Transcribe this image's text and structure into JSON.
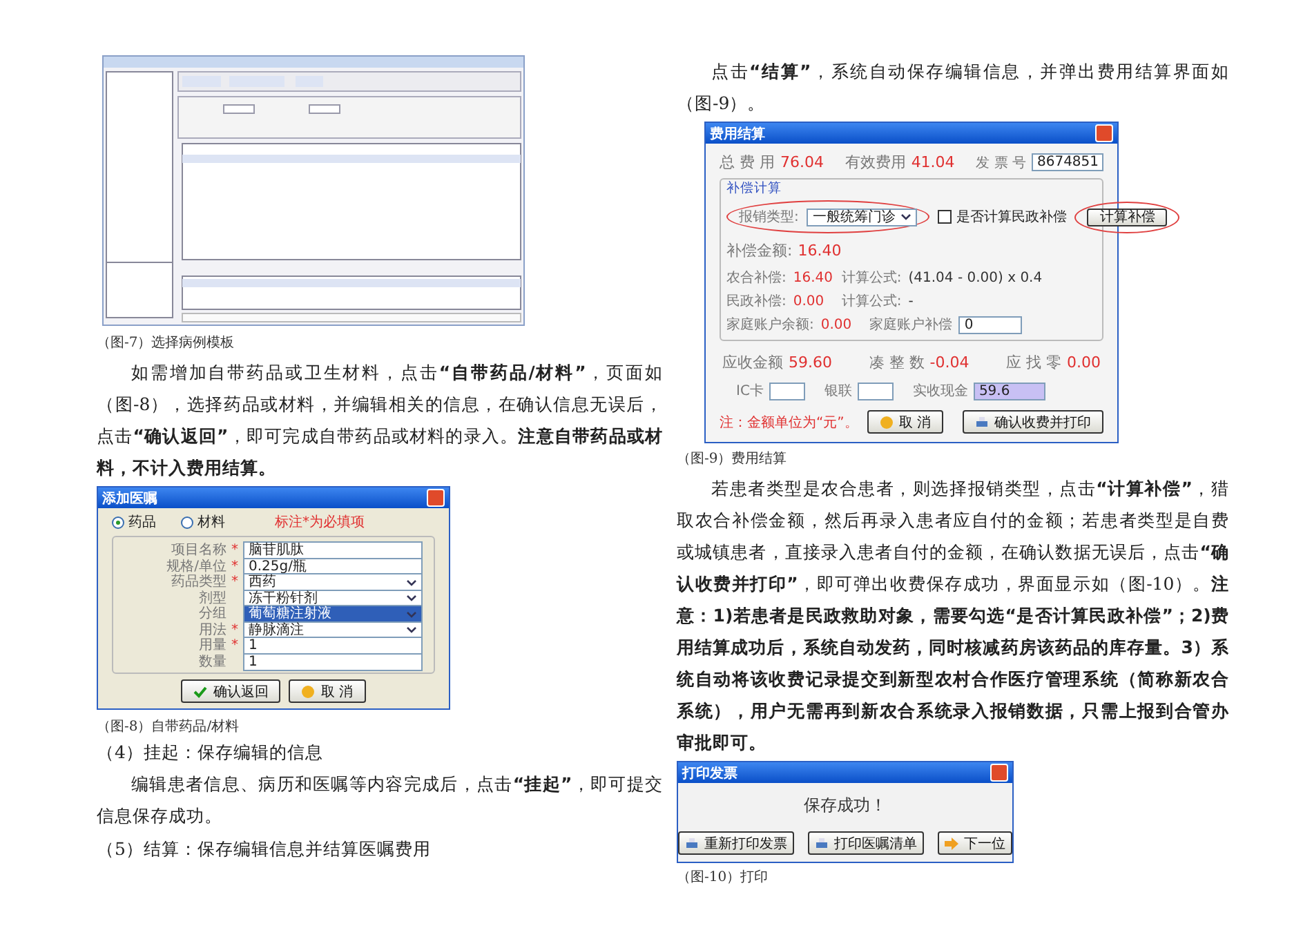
{
  "left": {
    "figure_7": {
      "caption": "（图-7）选择病例模板"
    },
    "paragraph_1": "如需增加自带药品或卫生材料，点击**“自带药品/材料”**，页面如（图-8），选择药品或材料，并编辑相关的信息，在确认信息无误后，点击**“确认返回”**，即可完成自带药品或材料的录入。**注意自带药品或材料，不计入费用结算。**",
    "figure_8": {
      "title": "添加医嘱",
      "radios": [
        {
          "label": "药品",
          "selected": true
        },
        {
          "label": "材料",
          "selected": false
        }
      ],
      "note": "标注*为必填项",
      "fields": [
        {
          "label": "项目名称",
          "mark": "*",
          "kind": "text",
          "value": "脑苷肌肽",
          "highlighted": false
        },
        {
          "label": "规格/单位",
          "mark": "*",
          "kind": "text",
          "value": "0.25g/瓶",
          "highlighted": false
        },
        {
          "label": "药品类型",
          "mark": "*",
          "kind": "select",
          "value": "西药",
          "highlighted": false
        },
        {
          "label": "剂型",
          "kind": "select",
          "value": "冻干粉针剂",
          "highlighted": false
        },
        {
          "label": "分组",
          "kind": "select",
          "value": "葡萄糖注射液",
          "highlighted": true
        },
        {
          "label": "用法",
          "mark": "*",
          "kind": "select",
          "value": "静脉滴注",
          "highlighted": false
        },
        {
          "label": "用量",
          "mark": "*",
          "kind": "text",
          "value": "1",
          "highlighted": false
        },
        {
          "label": "数量",
          "kind": "text",
          "value": "1",
          "highlighted": false
        }
      ],
      "buttons": [
        {
          "label": "确认返回",
          "kind": "confirm"
        },
        {
          "label": "取 消",
          "kind": "cancel"
        }
      ],
      "caption": "（图-8）自带药品/材料"
    },
    "section_4": "（4）挂起：保存编辑的信息",
    "paragraph_2": "编辑患者信息、病历和医嘱等内容完成后，点击**“挂起”**，即可提交信息保存成功。",
    "section_5": "（5）结算：保存编辑信息并结算医嘱费用"
  },
  "right": {
    "paragraph_3": "点击**“结算”**，系统自动保存编辑信息，并弹出费用结算界面如（图-9）。",
    "figure_9": {
      "title": "费用结算",
      "totals": [
        {
          "label": "总 费 用",
          "value": "76.04"
        },
        {
          "label": "有效费用",
          "value": "41.04"
        }
      ],
      "invoice": {
        "label": "发 票 号",
        "value": "8674851"
      },
      "compensation": {
        "title": "补偿计算",
        "type_label": "报销类型:",
        "type_value": "一般统筹门诊",
        "checkbox": {
          "label": "是否计算民政补偿",
          "checked": false
        },
        "button": "计算补偿",
        "amount": {
          "label": "补偿金额:",
          "value": "16.40"
        },
        "rows": [
          {
            "kind": "formula",
            "label": "农合补偿:",
            "value": "16.40",
            "label_2": "计算公式:",
            "value_2": "(41.04 - 0.00) x 0.4"
          },
          {
            "kind": "formula",
            "label": "民政补偿:",
            "value": "0.00",
            "label_2": "计算公式:",
            "value_2": "-"
          },
          {
            "kind": "field",
            "label": "家庭账户余额:",
            "value": "0.00",
            "label_2": "家庭账户补偿",
            "value_2": "0"
          }
        ]
      },
      "summary": [
        {
          "label": "应收金额",
          "value": "59.60"
        },
        {
          "label": "凑 整 数",
          "value": "-0.04"
        },
        {
          "label": "应 找 零",
          "value": "0.00"
        }
      ],
      "payment": [
        {
          "label": "IC卡",
          "highlighted": false
        },
        {
          "label": "银联",
          "highlighted": false
        },
        {
          "label": "实收现金",
          "value": "59.6",
          "highlighted": true
        }
      ],
      "note": "注：金额单位为“元”。",
      "buttons": [
        {
          "label": "取 消",
          "kind": "cancel"
        },
        {
          "label": "确认收费并打印",
          "kind": "print"
        }
      ],
      "caption": "（图-9）费用结算"
    },
    "paragraph_4": "若患者类型是农合患者，则选择报销类型，点击**“计算补偿”**，猎取农合补偿金额，然后再录入患者应自付的金额；若患者类型是自费或城镇患者，直接录入患者自付的金额，在确认数据无误后，点击**“确认收费并打印”**，即可弹出收费保存成功，界面显示如（图-10）。**注意：1)若患者是民政救助对象，需要勾选“是否计算民政补偿”；2)费用结算成功后，系统自动发药，同时核减药房该药品的库存量。3）系统自动将该收费记录提交到新型农村合作医疗管理系统（简称新农合系统），用户无需再到新农合系统录入报销数据，只需上报到合管办审批即可。**",
    "figure_10": {
      "title": "打印发票",
      "message": "保存成功！",
      "buttons": [
        {
          "label": "重新打印发票",
          "kind": "print"
        },
        {
          "label": "打印医嘱清单",
          "kind": "print"
        },
        {
          "label": "下一位",
          "kind": "next"
        }
      ],
      "caption": "（图-10）打印"
    }
  }
}
